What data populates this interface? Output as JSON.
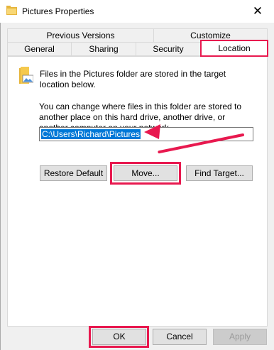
{
  "window": {
    "title": "Pictures Properties",
    "close_glyph": "✕"
  },
  "tabs": {
    "top_row": [
      "Previous Versions",
      "Customize"
    ],
    "bottom_row": [
      "General",
      "Sharing",
      "Security",
      "Location"
    ],
    "active": "Location"
  },
  "location": {
    "intro": "Files in the Pictures folder are stored in the target location below.",
    "description": "You can change where files in this folder are stored to another place on this hard drive, another drive, or another computer on your network.",
    "path_value": "C:\\Users\\Richard\\Pictures"
  },
  "buttons": {
    "restore_default": "Restore Default",
    "move": "Move...",
    "find_target": "Find Target...",
    "ok": "OK",
    "cancel": "Cancel",
    "apply": "Apply"
  },
  "colors": {
    "highlight": "#e8194f",
    "selection": "#0078d7"
  }
}
